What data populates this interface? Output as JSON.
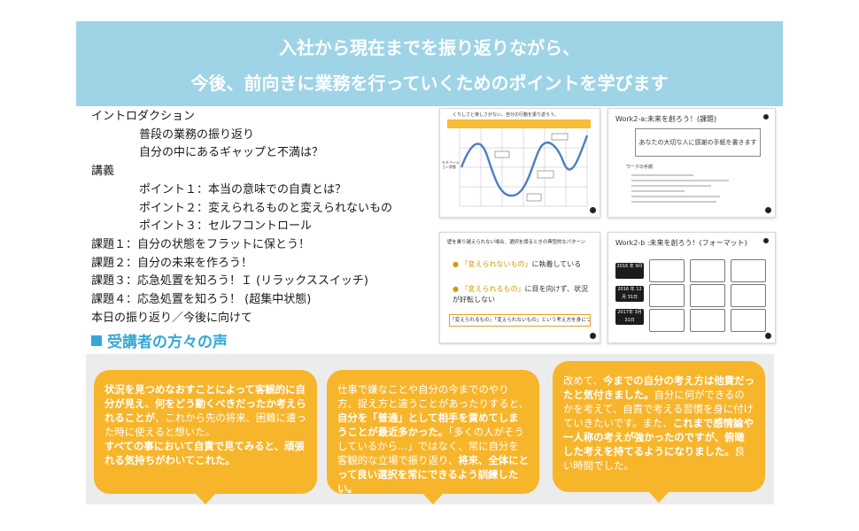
{
  "banner": {
    "line1": "入社から現在までを振り返りながら、",
    "line2": "今後、前向きに業務を行っていくためのポイントを学びます"
  },
  "agenda": [
    {
      "text": "イントロダクション",
      "indent": false
    },
    {
      "text": "普段の業務の振り返り",
      "indent": true
    },
    {
      "text": "自分の中にあるギャップと不満は？",
      "indent": true
    },
    {
      "text": "講義",
      "indent": false
    },
    {
      "text": "ポイント１：本当の意味での自責とは？",
      "indent": true
    },
    {
      "text": "ポイント２：変えられるものと変えられないもの",
      "indent": true
    },
    {
      "text": "ポイント３：セルフコントロール",
      "indent": true
    },
    {
      "text": "課題１：自分の状態をフラットに保とう！",
      "indent": false
    },
    {
      "text": "課題２：自分の未来を作ろう！",
      "indent": false
    },
    {
      "text": "課題３：応急処置を知ろう！Ｉ (リラックススイッチ)",
      "indent": false
    },
    {
      "text": "課題４：応急処置を知ろう！ (超集中状態)",
      "indent": false
    },
    {
      "text": "本日の振り返り／今後に向けて",
      "indent": false
    }
  ],
  "voices_title": "受講者の方々の声",
  "slides": {
    "chart": {
      "caption": "くりしさと楽しさがない、自分の行動を振り返ろう。",
      "label": "モチベーション状態"
    },
    "work2a": {
      "title": "Work2-a:未来を創ろう！(課題)",
      "box": "あなたの大切な人に感謝の手紙を書きます",
      "note": "ワークの手順"
    },
    "change": {
      "title": "壁を乗り越えられない場合、選択を誤るときの典型的なパターン",
      "item1_hl": "「変えられないもの」",
      "item1_rest": "に執着している",
      "item2_hl": "「変えられるもの」",
      "item2_rest": "に目を向けず、状況が好転しない",
      "footer": "「変えられるもの」「変えられないもの」という考え方を身につける"
    },
    "work2b": {
      "title": "Work2-b :未来を創ろう！(フォーマット)",
      "rows": [
        "2016 年 9月",
        "2016 年 12月 31日",
        "2017年 3月 31日"
      ]
    }
  },
  "bubbles": [
    [
      {
        "t": "状況を見つめなおすことによって客観的に自分が見え、何をどう動くべきだったか考えられることが",
        "b": true
      },
      {
        "t": "、これから先の将来、困難に遭った時に使えると想いた。",
        "b": false
      },
      {
        "t": "すべての事において自責で見てみると、頑張れる気持ちがわいてこれた。",
        "b": true
      }
    ],
    [
      {
        "t": "仕事で嫌なことや自分の今までのやり方、捉え方と違うことがあったりすると、",
        "b": false
      },
      {
        "t": "自分を「普通」として相手を責めてしまうことが最近多かった。",
        "b": true
      },
      {
        "t": "「多くの人がそうしているから…」ではなく、常に自分を客観的な立場で振り返り、",
        "b": false
      },
      {
        "t": "将来、全体にとって良い選択を常にできるよう訓練したい。",
        "b": true
      }
    ],
    [
      {
        "t": "改めて、",
        "b": false
      },
      {
        "t": "今までの自分の考え方は他責だったと気付きました。",
        "b": true
      },
      {
        "t": "自分に何ができるのかを考えて、自責で考える習慣を身に付けていきたいです。また、",
        "b": false
      },
      {
        "t": "これまで感情論や一人称の考えが強かったのですが、俯瞰した考えを持てるようになりました。",
        "b": true
      },
      {
        "t": "良い時間でした。",
        "b": false
      }
    ]
  ]
}
